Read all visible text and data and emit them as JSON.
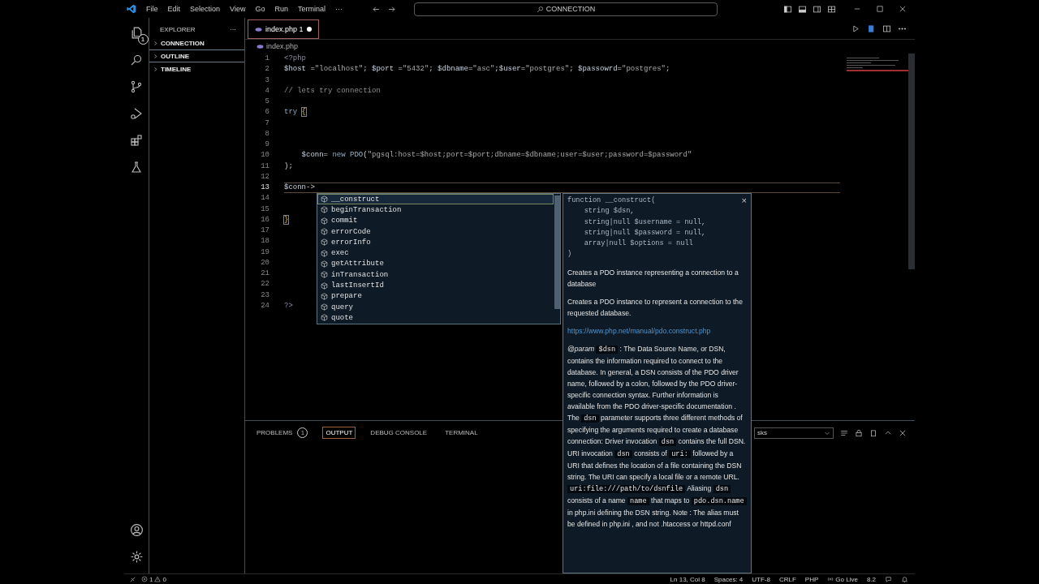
{
  "title_bar": {
    "menu": [
      "File",
      "Edit",
      "Selection",
      "View",
      "Go",
      "Run",
      "Terminal"
    ],
    "more": "···",
    "command_center": "CONNECTION"
  },
  "activity_bar": {
    "explorer_badge": "1"
  },
  "sidebar": {
    "title": "EXPLORER",
    "more": "···",
    "sections": [
      {
        "label": "CONNECTION",
        "expanded": false,
        "selected": false
      },
      {
        "label": "OUTLINE",
        "expanded": false,
        "selected": true
      },
      {
        "label": "TIMELINE",
        "expanded": false,
        "selected": false
      }
    ]
  },
  "editor": {
    "tabs": [
      {
        "label": "index.php",
        "problems": "1",
        "modified": true,
        "selected": true
      }
    ],
    "breadcrumb": "index.php",
    "lines": [
      {
        "number": "1",
        "current": false,
        "tokens": [
          {
            "kind": "tag",
            "text": "<?php"
          }
        ]
      },
      {
        "number": "2",
        "current": false,
        "tokens": [
          {
            "kind": "var",
            "text": "$host"
          },
          {
            "kind": "plain",
            "text": " ="
          },
          {
            "kind": "str",
            "text": "\"localhost\""
          },
          {
            "kind": "plain",
            "text": "; "
          },
          {
            "kind": "var",
            "text": "$port"
          },
          {
            "kind": "plain",
            "text": " ="
          },
          {
            "kind": "str",
            "text": "\"5432\""
          },
          {
            "kind": "plain",
            "text": "; "
          },
          {
            "kind": "var",
            "text": "$dbname"
          },
          {
            "kind": "plain",
            "text": "="
          },
          {
            "kind": "str",
            "text": "\"asc\""
          },
          {
            "kind": "plain",
            "text": ";"
          },
          {
            "kind": "var",
            "text": "$user"
          },
          {
            "kind": "plain",
            "text": "="
          },
          {
            "kind": "str",
            "text": "\"postgres\""
          },
          {
            "kind": "plain",
            "text": "; "
          },
          {
            "kind": "var",
            "text": "$passowrd"
          },
          {
            "kind": "plain",
            "text": "="
          },
          {
            "kind": "str",
            "text": "\"postgres\""
          },
          {
            "kind": "plain",
            "text": ";"
          }
        ]
      },
      {
        "number": "3",
        "current": false
      },
      {
        "number": "4",
        "current": false,
        "tokens": [
          {
            "kind": "comment",
            "text": "// lets try connection"
          }
        ]
      },
      {
        "number": "5",
        "current": false
      },
      {
        "number": "6",
        "current": false,
        "tokens": [
          {
            "kind": "keyword",
            "text": "try "
          },
          {
            "kind": "bracket",
            "text": "{"
          }
        ]
      },
      {
        "number": "7",
        "current": false
      },
      {
        "number": "8",
        "current": false
      },
      {
        "number": "9",
        "current": false
      },
      {
        "number": "10",
        "current": false,
        "tokens": [
          {
            "kind": "var",
            "text": "    $conn"
          },
          {
            "kind": "plain",
            "text": "= "
          },
          {
            "kind": "keyword",
            "text": "new "
          },
          {
            "kind": "class",
            "text": "PDO"
          },
          {
            "kind": "plain",
            "text": "("
          },
          {
            "kind": "str",
            "text": "\"pgsql:host=$host;port=$port;dbname=$dbname;user=$user;password=$password\""
          }
        ]
      },
      {
        "number": "11",
        "current": false,
        "tokens": [
          {
            "kind": "plain",
            "text": ");"
          }
        ]
      },
      {
        "number": "12",
        "current": false
      },
      {
        "number": "13",
        "current": true,
        "tokens": [
          {
            "kind": "var",
            "text": "$conn"
          },
          {
            "kind": "plain",
            "text": "->"
          }
        ]
      },
      {
        "number": "14",
        "current": false
      },
      {
        "number": "15",
        "current": false
      },
      {
        "number": "16",
        "current": false,
        "tokens": [
          {
            "kind": "bracket",
            "text": "}"
          }
        ]
      },
      {
        "number": "17",
        "current": false
      },
      {
        "number": "18",
        "current": false
      },
      {
        "number": "19",
        "current": false
      },
      {
        "number": "20",
        "current": false
      },
      {
        "number": "21",
        "current": false
      },
      {
        "number": "22",
        "current": false
      },
      {
        "number": "23",
        "current": false
      },
      {
        "number": "24",
        "current": false,
        "tokens": [
          {
            "kind": "tag",
            "text": "?>"
          }
        ]
      }
    ]
  },
  "suggest": {
    "items": [
      {
        "label": "__construct",
        "selected": true
      },
      {
        "label": "beginTransaction",
        "selected": false
      },
      {
        "label": "commit",
        "selected": false
      },
      {
        "label": "errorCode",
        "selected": false
      },
      {
        "label": "errorInfo",
        "selected": false
      },
      {
        "label": "exec",
        "selected": false
      },
      {
        "label": "getAttribute",
        "selected": false
      },
      {
        "label": "inTransaction",
        "selected": false
      },
      {
        "label": "lastInsertId",
        "selected": false
      },
      {
        "label": "prepare",
        "selected": false
      },
      {
        "label": "query",
        "selected": false
      },
      {
        "label": "quote",
        "selected": false
      }
    ],
    "details": {
      "close": "×",
      "signature": "function __construct(\n    string $dsn,\n    string|null $username = null,\n    string|null $password = null,\n    array|null $options = null\n)",
      "summary": "Creates a PDO instance representing a connection to a database",
      "description": "Creates a PDO instance to represent a connection to the requested database.",
      "link": "https://www.php.net/manual/pdo.construct.php",
      "param": [
        {
          "kind": "italic",
          "text": "@param"
        },
        {
          "kind": "code",
          "text": "$dsn"
        },
        {
          "kind": "text",
          "text": ": The Data Source Name, or DSN, contains the information required to connect to the database. In general, a DSN consists of the PDO driver name, followed by a colon, followed by the PDO driver-specific connection syntax. Further information is available from the PDO driver-specific documentation . The"
        },
        {
          "kind": "code",
          "text": "dsn"
        },
        {
          "kind": "text",
          "text": "parameter supports three different methods of specifying the arguments required to create a database connection: Driver invocation"
        },
        {
          "kind": "code",
          "text": "dsn"
        },
        {
          "kind": "text",
          "text": "contains the full DSN. URI invocation"
        },
        {
          "kind": "code",
          "text": "dsn"
        },
        {
          "kind": "text",
          "text": "consists of"
        },
        {
          "kind": "code",
          "text": "uri:"
        },
        {
          "kind": "text",
          "text": "followed by a URI that defines the location of a file containing the DSN string. The URI can specify a local file or a remote URL."
        },
        {
          "kind": "code",
          "text": "uri:file:///path/to/dsnfile"
        },
        {
          "kind": "text",
          "text": "Aliasing"
        },
        {
          "kind": "code",
          "text": "dsn"
        },
        {
          "kind": "text",
          "text": "consists of a name"
        },
        {
          "kind": "code",
          "text": "name"
        },
        {
          "kind": "text",
          "text": "that maps to"
        },
        {
          "kind": "code",
          "text": "pdo.dsn.name"
        },
        {
          "kind": "text",
          "text": "in php.ini defining the DSN string. Note : The alias must be defined in php.ini , and not .htaccess or httpd.conf"
        }
      ]
    }
  },
  "panel": {
    "tabs": [
      {
        "label": "PROBLEMS",
        "badge": "1",
        "selected": false
      },
      {
        "label": "OUTPUT",
        "selected": true
      },
      {
        "label": "DEBUG CONSOLE",
        "selected": false
      },
      {
        "label": "TERMINAL",
        "selected": false
      }
    ],
    "filter": "sks"
  },
  "status_bar": {
    "errors": "1",
    "warnings": "0",
    "items": [
      {
        "kind": "text",
        "text": "Ln 13, Col 8"
      },
      {
        "kind": "text",
        "text": "Spaces: 4"
      },
      {
        "kind": "text",
        "text": "UTF-8"
      },
      {
        "kind": "text",
        "text": "CRLF"
      },
      {
        "kind": "text",
        "text": "PHP"
      },
      {
        "kind": "live",
        "text": "Go Live"
      },
      {
        "kind": "text",
        "text": "8.2"
      }
    ]
  }
}
